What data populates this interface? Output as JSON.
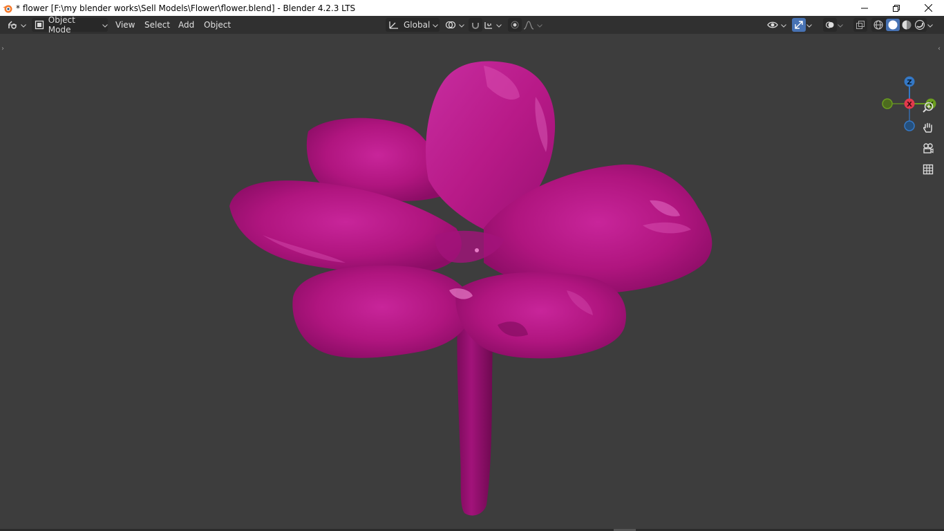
{
  "window": {
    "title": "* flower [F:\\my blender works\\Sell Models\\Flower\\flower.blend] - Blender 4.2.3 LTS",
    "controls": [
      "minimize-icon",
      "restore-icon",
      "close-icon"
    ]
  },
  "header": {
    "editor_type_icon": "editor-type-icon",
    "mode": "Object Mode",
    "menus": [
      "View",
      "Select",
      "Add",
      "Object"
    ],
    "transform_orientation": "Global",
    "icons": [
      "pivot-point-icon",
      "snap-icon",
      "snap-target-icon",
      "proportional-edit-icon",
      "falloff-icon",
      "visibility-icon",
      "gizmo-toggle-icon",
      "overlay-icon",
      "xray-icon",
      "wireframe-shading-icon",
      "solid-shading-icon",
      "material-shading-icon",
      "rendered-shading-icon"
    ]
  },
  "viewport": {
    "object": "flower",
    "object_color": "#b0157f",
    "background": "#3d3d3d",
    "gizmo": {
      "z": "Z",
      "x": "X",
      "y": "Y"
    },
    "nav_buttons": [
      "zoom-icon",
      "hand-pan-icon",
      "camera-icon",
      "perspective-grid-icon"
    ]
  },
  "colors": {
    "axis_x": "#e2394c",
    "axis_y": "#6b9e1f",
    "axis_z": "#3478c6",
    "accent": "#4772b3"
  }
}
